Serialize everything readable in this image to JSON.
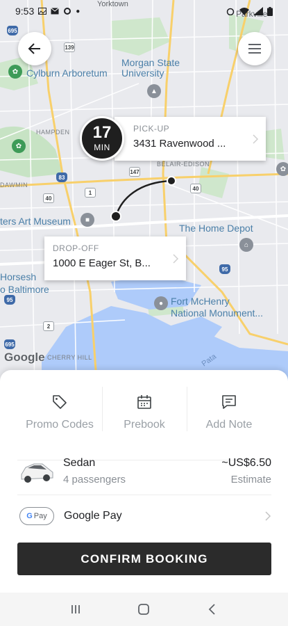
{
  "status_bar": {
    "time": "9:53"
  },
  "map": {
    "labels": {
      "cylburn": "Cylburn Arboretum",
      "morgan": "Morgan State\nUniversity",
      "artists": "ters Art Museum",
      "home_depot": "The Home Depot",
      "horseshoe": "Horsesh\no Baltimore",
      "fort": "Fort McHenry\nNational Monument...",
      "parkville": "Parkville",
      "hampden": "HAMPDEN",
      "belair": "BELAIR-EDISON",
      "cherry": "CHERRY HILL",
      "dawmin": "DAWMIN",
      "yorktown": "Yorktown",
      "patapsco": "Pata",
      "google": "Google"
    },
    "shields": [
      "139",
      "147",
      "695",
      "83",
      "40",
      "40",
      "95",
      "95",
      "695",
      "1",
      "2"
    ]
  },
  "eta": {
    "value": "17",
    "unit": "MIN"
  },
  "pickup": {
    "caption": "PICK-UP",
    "address": "3431 Ravenwood ..."
  },
  "dropoff": {
    "caption": "DROP-OFF",
    "address": "1000 E Eager St, B..."
  },
  "actions": [
    {
      "label": "Promo Codes",
      "icon": "tag-icon"
    },
    {
      "label": "Prebook",
      "icon": "calendar-icon"
    },
    {
      "label": "Add Note",
      "icon": "note-icon"
    }
  ],
  "ride": {
    "name": "Sedan",
    "passengers": "4 passengers",
    "price": "~US$6.50",
    "estimate": "Estimate"
  },
  "payment": {
    "badge_g": "G",
    "badge_pay": "Pay",
    "name": "Google Pay"
  },
  "confirm_label": "CONFIRM BOOKING",
  "colors": {
    "accent": "#2b2b2b",
    "muted": "#9aa0a6"
  }
}
